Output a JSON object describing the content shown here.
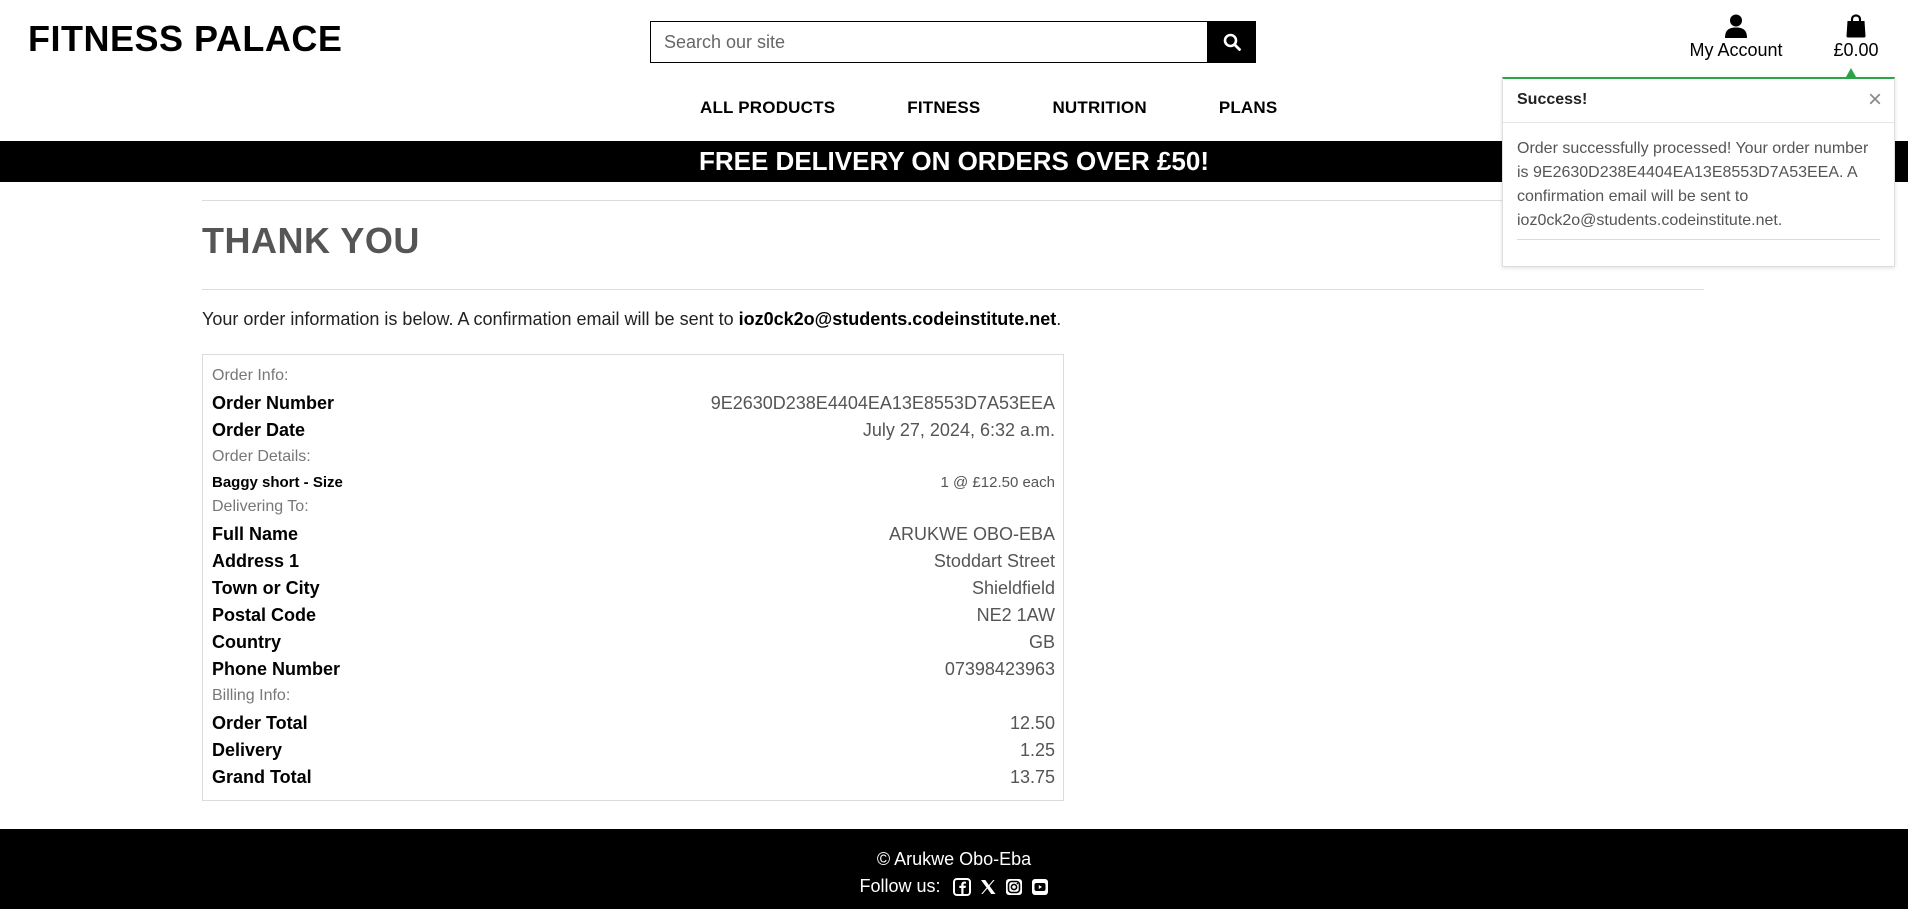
{
  "header": {
    "brand": "FITNESS PALACE",
    "search_placeholder": "Search our site",
    "account_label": "My Account",
    "bag_total": "£0.00",
    "nav": [
      "ALL PRODUCTS",
      "FITNESS",
      "NUTRITION",
      "PLANS"
    ]
  },
  "banner": {
    "text": "FREE DELIVERY ON ORDERS OVER £50!"
  },
  "main": {
    "title": "THANK YOU",
    "intro_prefix": "Your order information is below. A confirmation email will be sent to ",
    "intro_email": "ioz0ck2o@students.codeinstitute.net",
    "intro_suffix": "."
  },
  "order": {
    "order_info_heading": "Order Info:",
    "order_number_label": "Order Number",
    "order_number": "9E2630D238E4404EA13E8553D7A53EEA",
    "order_date_label": "Order Date",
    "order_date": "July 27, 2024, 6:32 a.m.",
    "details_heading": "Order Details:",
    "item_name": "Baggy short - Size",
    "item_qty": "1 @ £12.50 each",
    "delivering_heading": "Delivering To:",
    "full_name_label": "Full Name",
    "full_name": "ARUKWE OBO-EBA",
    "address1_label": "Address 1",
    "address1": "Stoddart Street",
    "town_label": "Town or City",
    "town": "Shieldfield",
    "postal_label": "Postal Code",
    "postal": "NE2 1AW",
    "country_label": "Country",
    "country": "GB",
    "phone_label": "Phone Number",
    "phone": "07398423963",
    "billing_heading": "Billing Info:",
    "order_total_label": "Order Total",
    "order_total": "12.50",
    "delivery_label": "Delivery",
    "delivery": "1.25",
    "grand_total_label": "Grand Total",
    "grand_total": "13.75"
  },
  "toast": {
    "title": "Success!",
    "close": "×",
    "message": "Order successfully processed! Your order number is 9E2630D238E4404EA13E8553D7A53EEA. A confirmation email will be sent to ioz0ck2o@students.codeinstitute.net.",
    "accent_color": "#2aa547"
  },
  "footer": {
    "copyright": "© Arukwe Obo-Eba",
    "follow_label": "Follow us:",
    "social_icons": [
      "facebook-icon",
      "x-twitter-icon",
      "instagram-icon",
      "youtube-icon"
    ]
  }
}
